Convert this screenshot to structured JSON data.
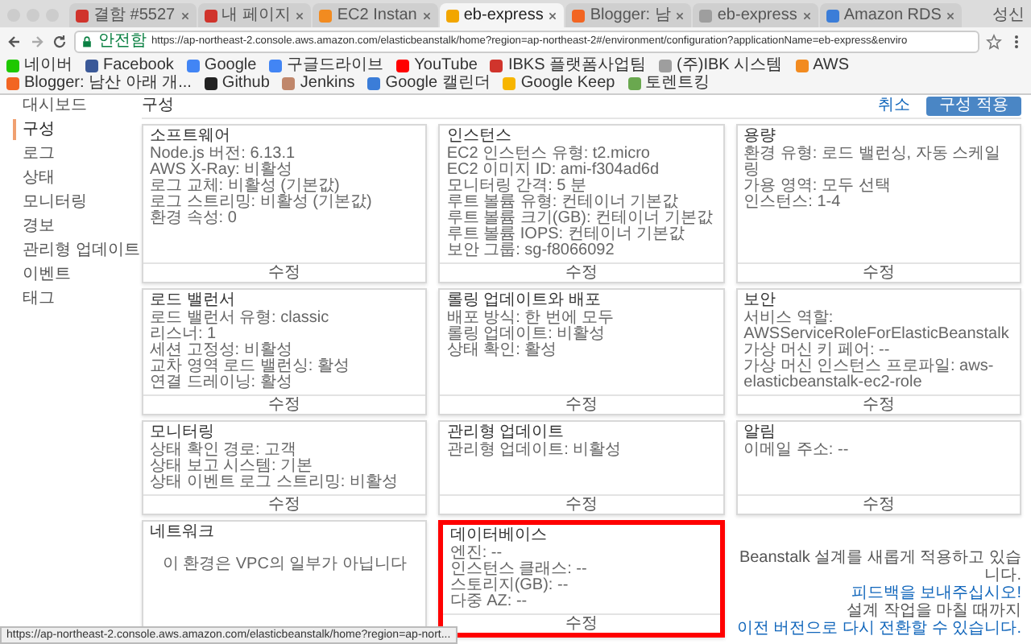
{
  "browser": {
    "tabs": [
      {
        "title": "결함 #5527",
        "selected": false,
        "color": "#d0342c"
      },
      {
        "title": "내 페이지",
        "selected": false,
        "color": "#d0342c"
      },
      {
        "title": "EC2 Instan",
        "selected": false,
        "color": "#f28b20"
      },
      {
        "title": "eb-express",
        "selected": true,
        "color": "#f2a600"
      },
      {
        "title": "Blogger: 남",
        "selected": false,
        "color": "#f26522"
      },
      {
        "title": "eb-express",
        "selected": false,
        "color": "#9e9e9e"
      },
      {
        "title": "Amazon RDS",
        "selected": false,
        "color": "#3b7dd8"
      }
    ],
    "profile": "성신",
    "address": {
      "security": "안전함",
      "url": "https://ap-northeast-2.console.aws.amazon.com/elasticbeanstalk/home?region=ap-northeast-2#/environment/configuration?applicationName=eb-express&enviro"
    },
    "bookmarks": [
      {
        "label": "네이버",
        "color": "#1ec800"
      },
      {
        "label": "Facebook",
        "color": "#3b5998"
      },
      {
        "label": "Google",
        "color": "#4285f4"
      },
      {
        "label": "구글드라이브",
        "color": "#4285f4"
      },
      {
        "label": "YouTube",
        "color": "#ff0000"
      },
      {
        "label": "IBKS 플랫폼사업팀",
        "color": "#d0342c"
      },
      {
        "label": "(주)IBK 시스템",
        "color": "#9e9e9e"
      },
      {
        "label": "AWS",
        "color": "#f28b20"
      },
      {
        "label": "Blogger: 남산 아래 개...",
        "color": "#f26522"
      },
      {
        "label": "Github",
        "color": "#222222"
      },
      {
        "label": "Jenkins",
        "color": "#c0876b"
      },
      {
        "label": "Google 캘린더",
        "color": "#3b7dd8"
      },
      {
        "label": "Google Keep",
        "color": "#f7b500"
      },
      {
        "label": "토렌트킹",
        "color": "#6aa84f"
      }
    ]
  },
  "sidebar": {
    "items": [
      {
        "label": "대시보드",
        "selected": false
      },
      {
        "label": "구성",
        "selected": true
      },
      {
        "label": "로그",
        "selected": false
      },
      {
        "label": "상태",
        "selected": false
      },
      {
        "label": "모니터링",
        "selected": false
      },
      {
        "label": "경보",
        "selected": false
      },
      {
        "label": "관리형 업데이트",
        "selected": false
      },
      {
        "label": "이벤트",
        "selected": false
      },
      {
        "label": "태그",
        "selected": false
      }
    ]
  },
  "content": {
    "title": "구성",
    "cancel": "취소",
    "apply": "구성 적용",
    "cards": [
      {
        "kind": "list",
        "title": "소프트웨어",
        "highlighted": false,
        "action": "수정",
        "lines": [
          "Node.js 버전: 6.13.1",
          "AWS X-Ray: 비활성",
          "로그 교체: 비활성 (기본값)",
          "로그 스트리밍: 비활성 (기본값)",
          "환경 속성: 0"
        ]
      },
      {
        "kind": "list",
        "title": "인스턴스",
        "highlighted": false,
        "action": "수정",
        "lines": [
          "EC2 인스턴스 유형: t2.micro",
          "EC2 이미지 ID: ami-f304ad6d",
          "모니터링 간격: 5 분",
          "루트 볼륨 유형: 컨테이너 기본값",
          "루트 볼륨 크기(GB): 컨테이너 기본값",
          "루트 볼륨 IOPS: 컨테이너 기본값",
          "보안 그룹: sg-f8066092"
        ]
      },
      {
        "kind": "list",
        "title": "용량",
        "highlighted": false,
        "action": "수정",
        "lines": [
          "환경 유형: 로드 밸런싱, 자동 스케일링",
          "가용 영역: 모두 선택",
          "인스턴스: 1-4"
        ]
      },
      {
        "kind": "list",
        "title": "로드 밸런서",
        "highlighted": false,
        "action": "수정",
        "lines": [
          "로드 밸런서 유형: classic",
          "리스너: 1",
          "세션 고정성: 비활성",
          "교차 영역 로드 밸런싱: 활성",
          "연결 드레이닝: 활성"
        ]
      },
      {
        "kind": "list",
        "title": "롤링 업데이트와 배포",
        "highlighted": false,
        "action": "수정",
        "lines": [
          "배포 방식: 한 번에 모두",
          "롤링 업데이트: 비활성",
          "상태 확인: 활성"
        ]
      },
      {
        "kind": "list",
        "title": "보안",
        "highlighted": false,
        "action": "수정",
        "lines": [
          "서비스 역할: AWSServiceRoleForElasticBeanstalk",
          "가상 머신 키 페어: --",
          "가상 머신 인스턴스 프로파일: aws-elasticbeanstalk-ec2-role"
        ]
      },
      {
        "kind": "list",
        "title": "모니터링",
        "highlighted": false,
        "action": "수정",
        "lines": [
          "상태 확인 경로: 고객",
          "상태 보고 시스템: 기본",
          "상태 이벤트 로그 스트리밍: 비활성"
        ]
      },
      {
        "kind": "list",
        "title": "관리형 업데이트",
        "highlighted": false,
        "action": "수정",
        "lines": [
          "관리형 업데이트: 비활성"
        ]
      },
      {
        "kind": "list",
        "title": "알림",
        "highlighted": false,
        "action": "수정",
        "lines": [
          "이메일 주소: --"
        ]
      },
      {
        "kind": "notice",
        "title": "네트워크",
        "highlighted": false,
        "message": "이 환경은 VPC의 일부가 아닙니다"
      },
      {
        "kind": "list",
        "title": "데이터베이스",
        "highlighted": true,
        "action": "수정",
        "lines": [
          "엔진: --",
          "인스턴스 클래스: --",
          "스토리지(GB): --",
          "다중 AZ: --"
        ]
      }
    ]
  },
  "footer": {
    "parts": [
      {
        "kind": "text",
        "text": "Beanstalk 설계를 새롭게 적용하고 있습니다."
      },
      {
        "kind": "link",
        "text": "피드백을 보내주십시오!"
      },
      {
        "kind": "text",
        "text": "설계 작업을 마칠 때까지"
      },
      {
        "kind": "link",
        "text": "이전 버전으로 다시 전환할 수 있습니다."
      }
    ]
  },
  "status_url": "https://ap-northeast-2.console.aws.amazon.com/elasticbeanstalk/home?region=ap-nort..."
}
